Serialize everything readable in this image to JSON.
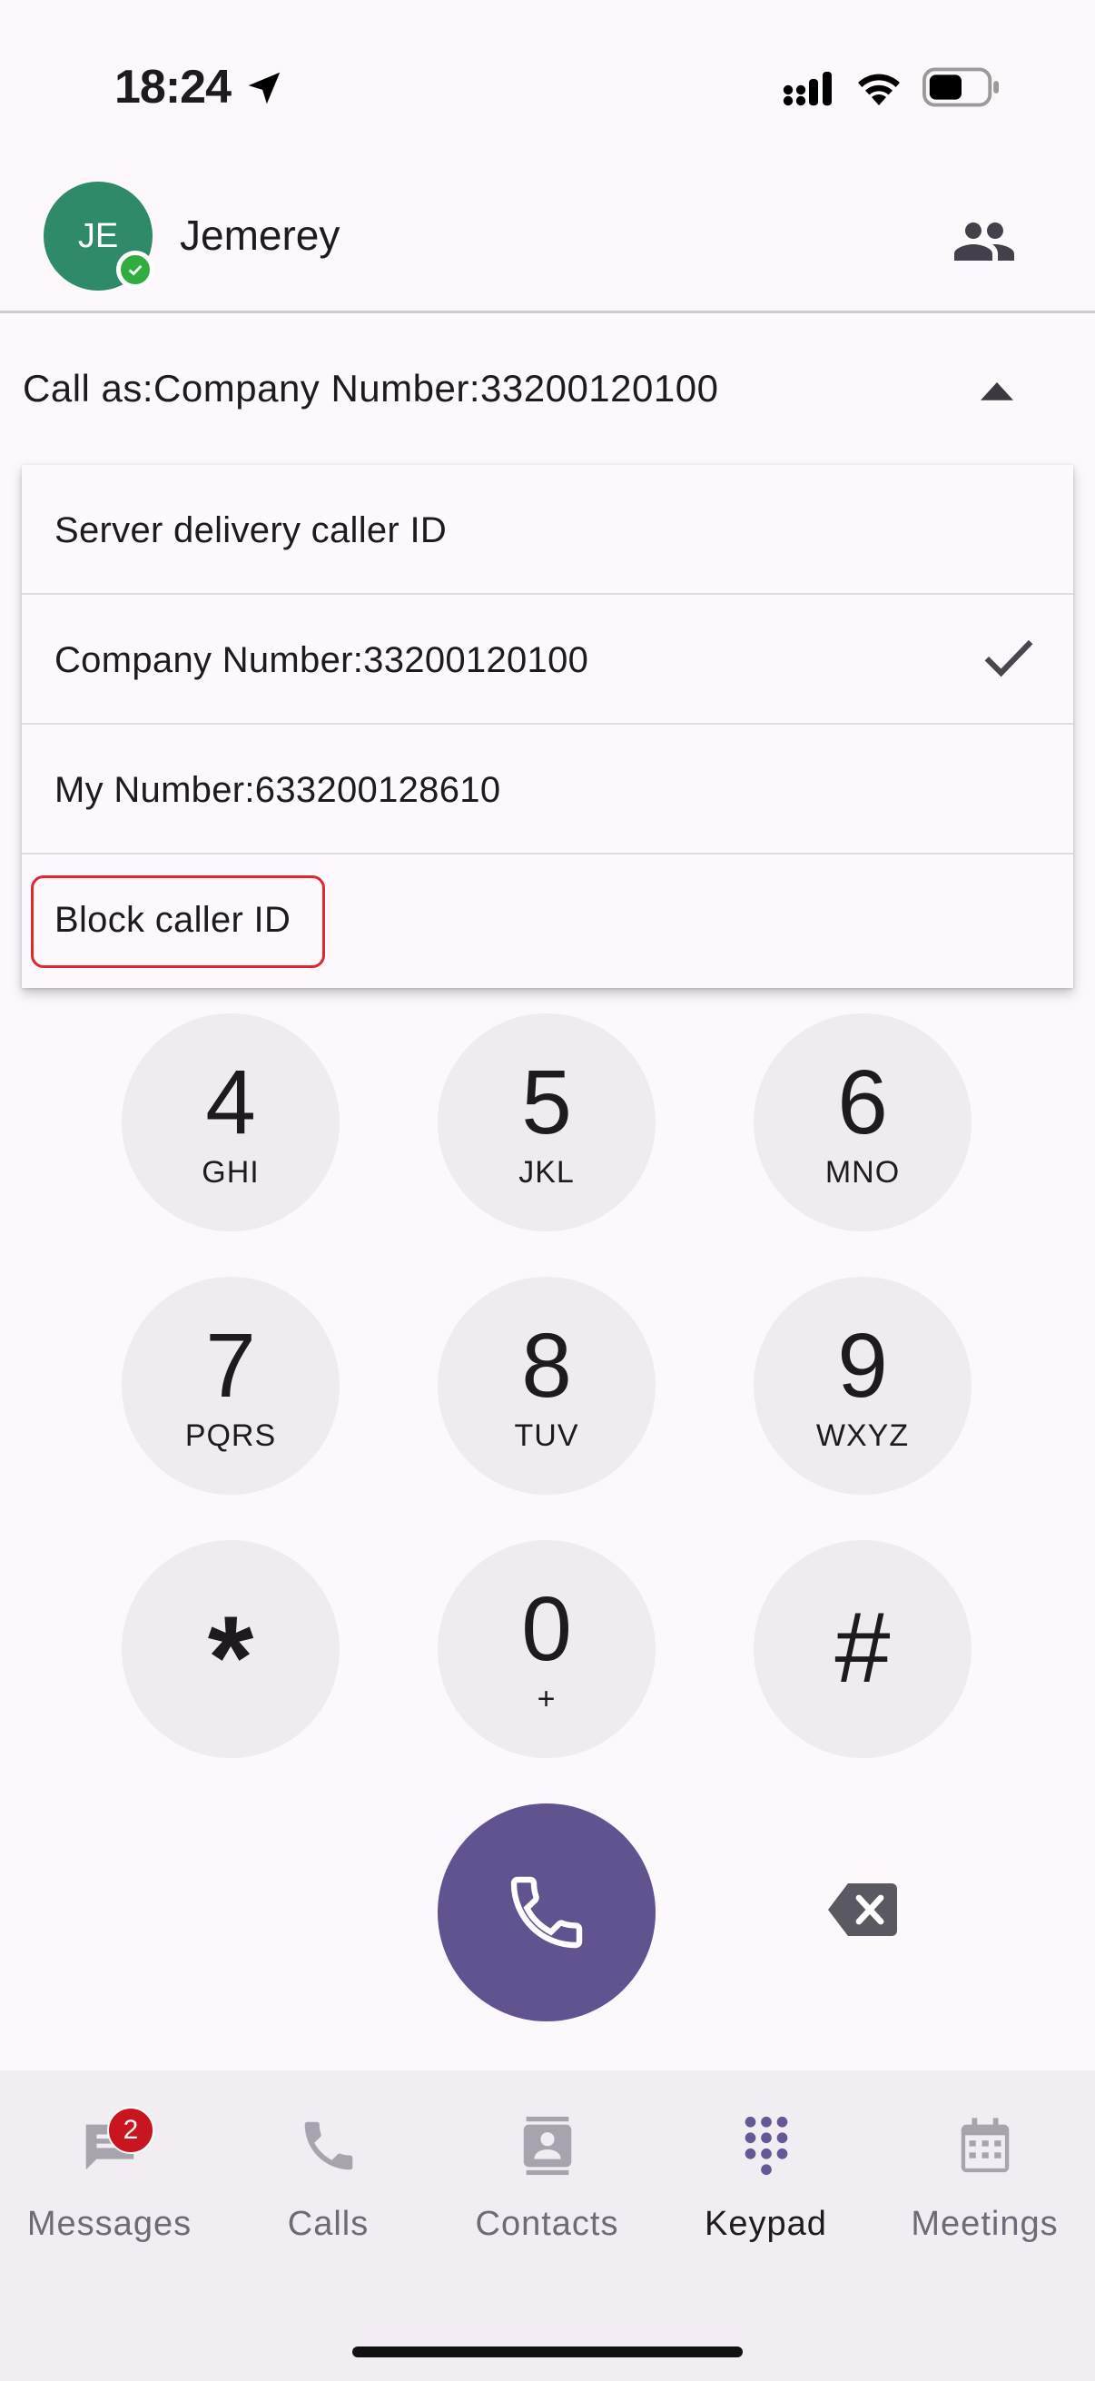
{
  "status_bar": {
    "time": "18:24"
  },
  "header": {
    "avatar_initials": "JE",
    "user_name": "Jemerey"
  },
  "call_as": {
    "label": "Call as:Company Number:33200120100"
  },
  "dropdown": {
    "items": [
      {
        "label": "Server delivery caller ID",
        "selected": false
      },
      {
        "label": "Company Number:33200120100",
        "selected": true
      },
      {
        "label": "My Number:633200128610",
        "selected": false
      },
      {
        "label": "Block caller ID",
        "selected": false,
        "highlighted": true
      }
    ]
  },
  "keypad": {
    "keys": [
      {
        "digit": "4",
        "letters": "GHI"
      },
      {
        "digit": "5",
        "letters": "JKL"
      },
      {
        "digit": "6",
        "letters": "MNO"
      },
      {
        "digit": "7",
        "letters": "PQRS"
      },
      {
        "digit": "8",
        "letters": "TUV"
      },
      {
        "digit": "9",
        "letters": "WXYZ"
      },
      {
        "digit": "*",
        "letters": ""
      },
      {
        "digit": "0",
        "letters": "+"
      },
      {
        "digit": "#",
        "letters": ""
      }
    ]
  },
  "bottom_nav": {
    "items": [
      {
        "label": "Messages",
        "icon": "messages-icon",
        "badge": "2",
        "active": false
      },
      {
        "label": "Calls",
        "icon": "phone-icon",
        "active": false
      },
      {
        "label": "Contacts",
        "icon": "contact-card-icon",
        "active": false
      },
      {
        "label": "Keypad",
        "icon": "dialpad-icon",
        "active": true
      },
      {
        "label": "Meetings",
        "icon": "calendar-icon",
        "active": false
      }
    ]
  },
  "colors": {
    "accent": "#615290",
    "avatar": "#2e8a68",
    "presence": "#2fae3f",
    "badge": "#c8151f",
    "highlight_border": "#e0262f"
  }
}
